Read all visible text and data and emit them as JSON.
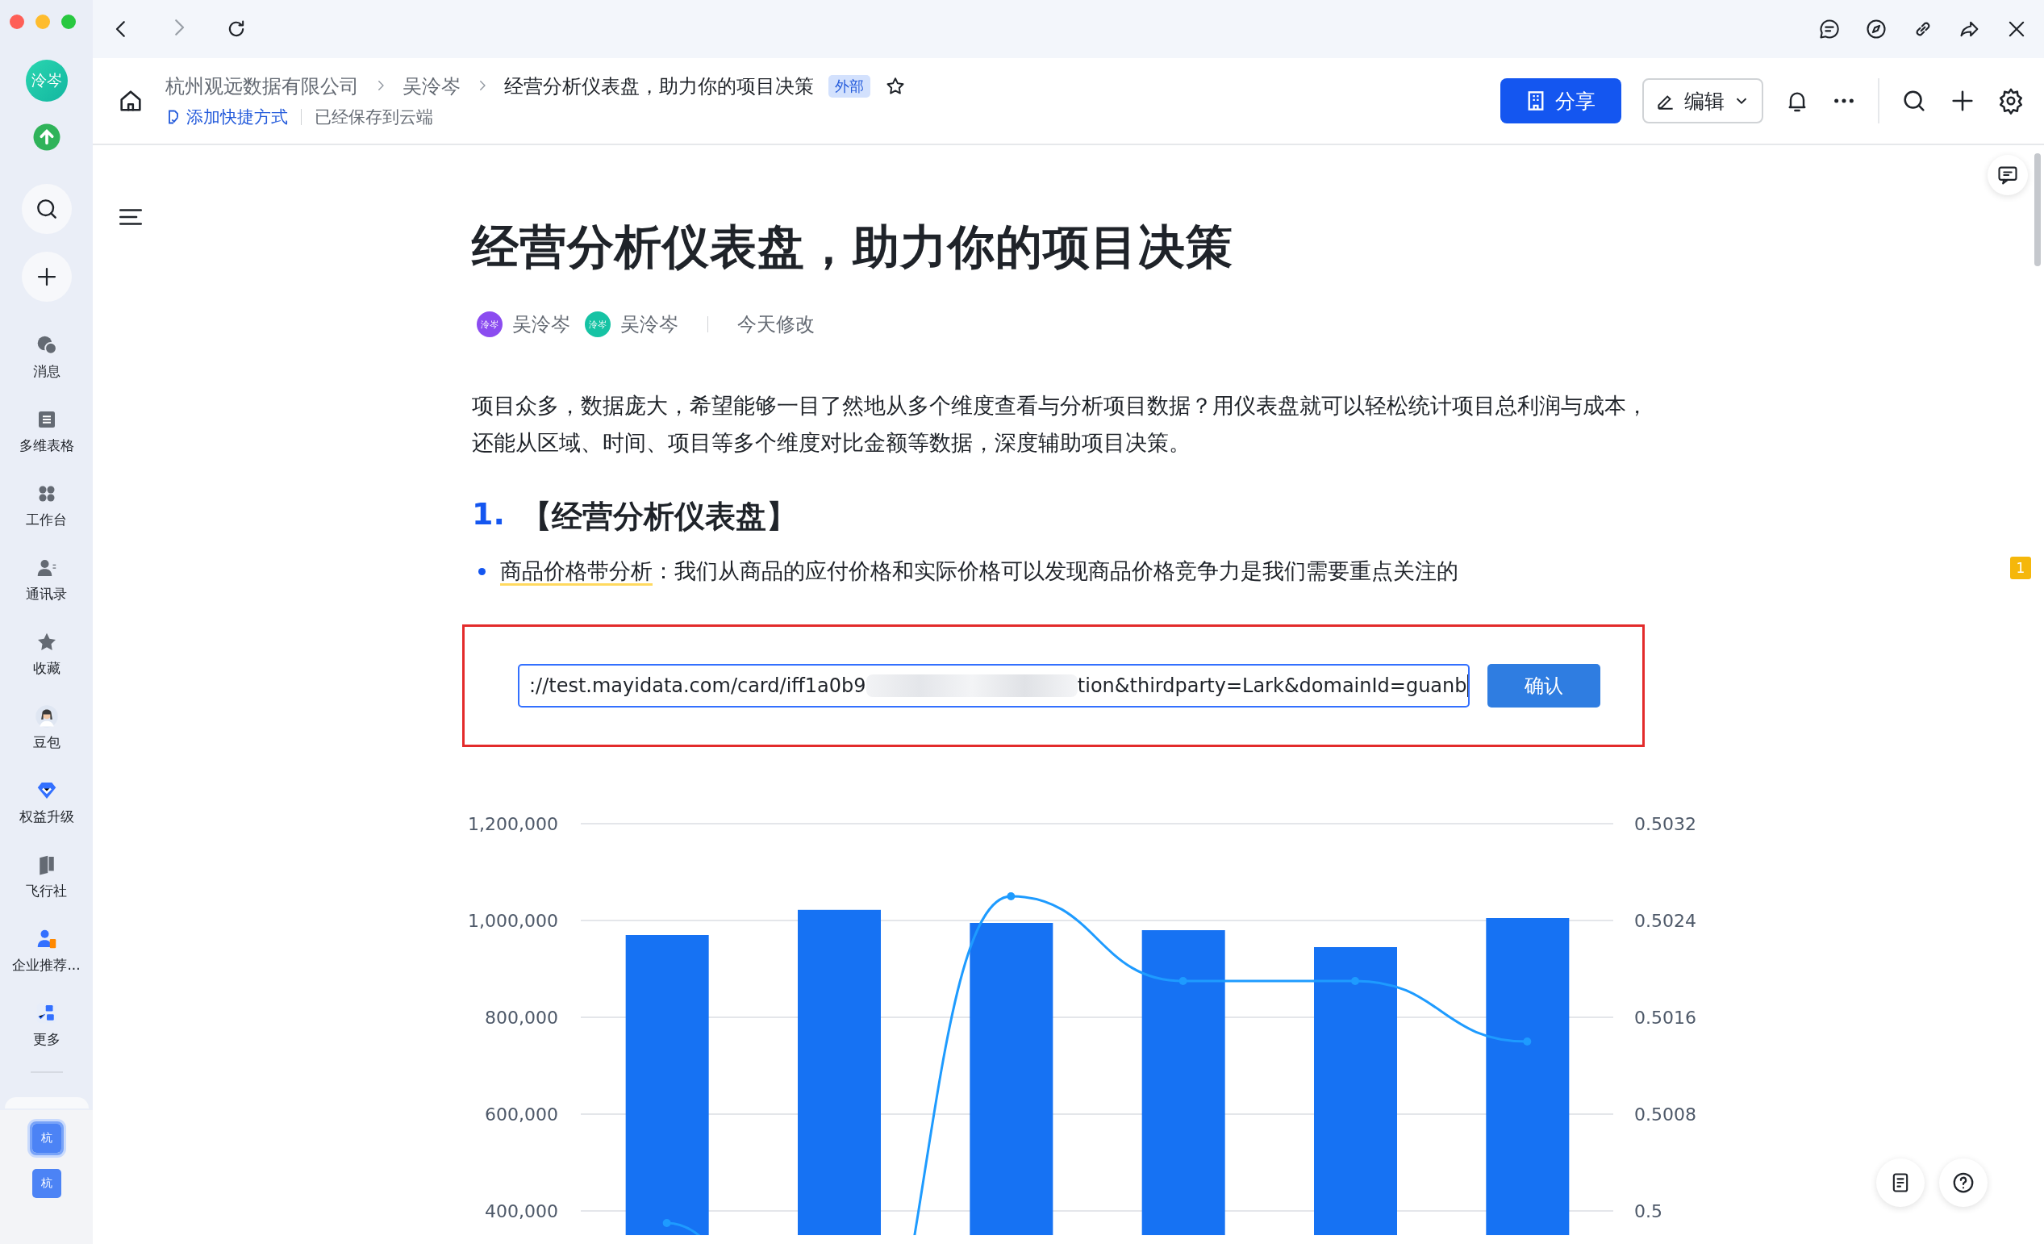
{
  "sidebar": {
    "avatar": "泠岑",
    "items": [
      {
        "label": "消息"
      },
      {
        "label": "多维表格"
      },
      {
        "label": "工作台"
      },
      {
        "label": "通讯录"
      },
      {
        "label": "收藏"
      },
      {
        "label": "豆包"
      },
      {
        "label": "权益升级"
      },
      {
        "label": "飞行社"
      },
      {
        "label": "企业推荐..."
      },
      {
        "label": "更多"
      }
    ],
    "workspaces": [
      {
        "label": "杭",
        "selected": true
      },
      {
        "label": "杭",
        "selected": false
      }
    ]
  },
  "breadcrumbs": [
    "杭州观远数据有限公司",
    "吴泠岑",
    "经营分析仪表盘，助力你的项目决策"
  ],
  "tag": "外部",
  "shortcut_link": "添加快捷方式",
  "save_status": "已经保存到云端",
  "share_button": "分享",
  "edit_button": "编辑",
  "document": {
    "title": "经营分析仪表盘，助力你的项目决策",
    "authors": [
      {
        "avatar": "泠岑",
        "name": "吴泠岑",
        "color": "#8b4cf0"
      },
      {
        "avatar": "泠岑",
        "name": "吴泠岑",
        "color": "#16c3a4"
      }
    ],
    "modified": "今天修改",
    "paragraph": "项目众多，数据庞大，希望能够一目了然地从多个维度查看与分析项目数据？用仪表盘就可以轻松统计项目总利润与成本，还能从区域、时间、项目等多个维度对比金额等数据，深度辅助项目决策。",
    "heading_number": "1.",
    "heading": "【经营分析仪表盘】",
    "bullet": {
      "anchor": "商品价格带分析",
      "text": "：我们从商品的应付价格和实际价格可以发现商品价格竞争力是我们需要重点关注的"
    },
    "embed": {
      "value_start": "://test.mayidata.com/card/iff1a0b9",
      "value_end": "tion&thirdparty=Lark&domainId=guanb",
      "confirm": "确认"
    },
    "chart_data": {
      "type": "bar",
      "grid": true,
      "ylim": [
        350000,
        1200000
      ],
      "y2lim": [
        0.4998,
        0.5032
      ],
      "yticks": [
        {
          "value": 400000,
          "label": "400,000"
        },
        {
          "value": 600000,
          "label": "600,000"
        },
        {
          "value": 800000,
          "label": "800,000"
        },
        {
          "value": 1000000,
          "label": "1,000,000"
        },
        {
          "value": 1200000,
          "label": "1,200,000"
        }
      ],
      "y2ticks": [
        {
          "value": 0.5,
          "label": "0.5"
        },
        {
          "value": 0.5008,
          "label": "0.5008"
        },
        {
          "value": 0.5016,
          "label": "0.5016"
        },
        {
          "value": 0.5024,
          "label": "0.5024"
        },
        {
          "value": 0.5032,
          "label": "0.5032"
        }
      ],
      "series": [
        {
          "type": "bar",
          "color": "#1672f3",
          "values": [
            970000,
            1022000,
            995000,
            980000,
            945000,
            1005000
          ]
        },
        {
          "type": "line",
          "axis": "y2",
          "marker": "circle",
          "color": "#1e9bff",
          "values": [
            0.4999,
            null,
            0.5026,
            0.5019,
            0.5019,
            0.5014
          ]
        }
      ]
    }
  },
  "comment_count": "1"
}
